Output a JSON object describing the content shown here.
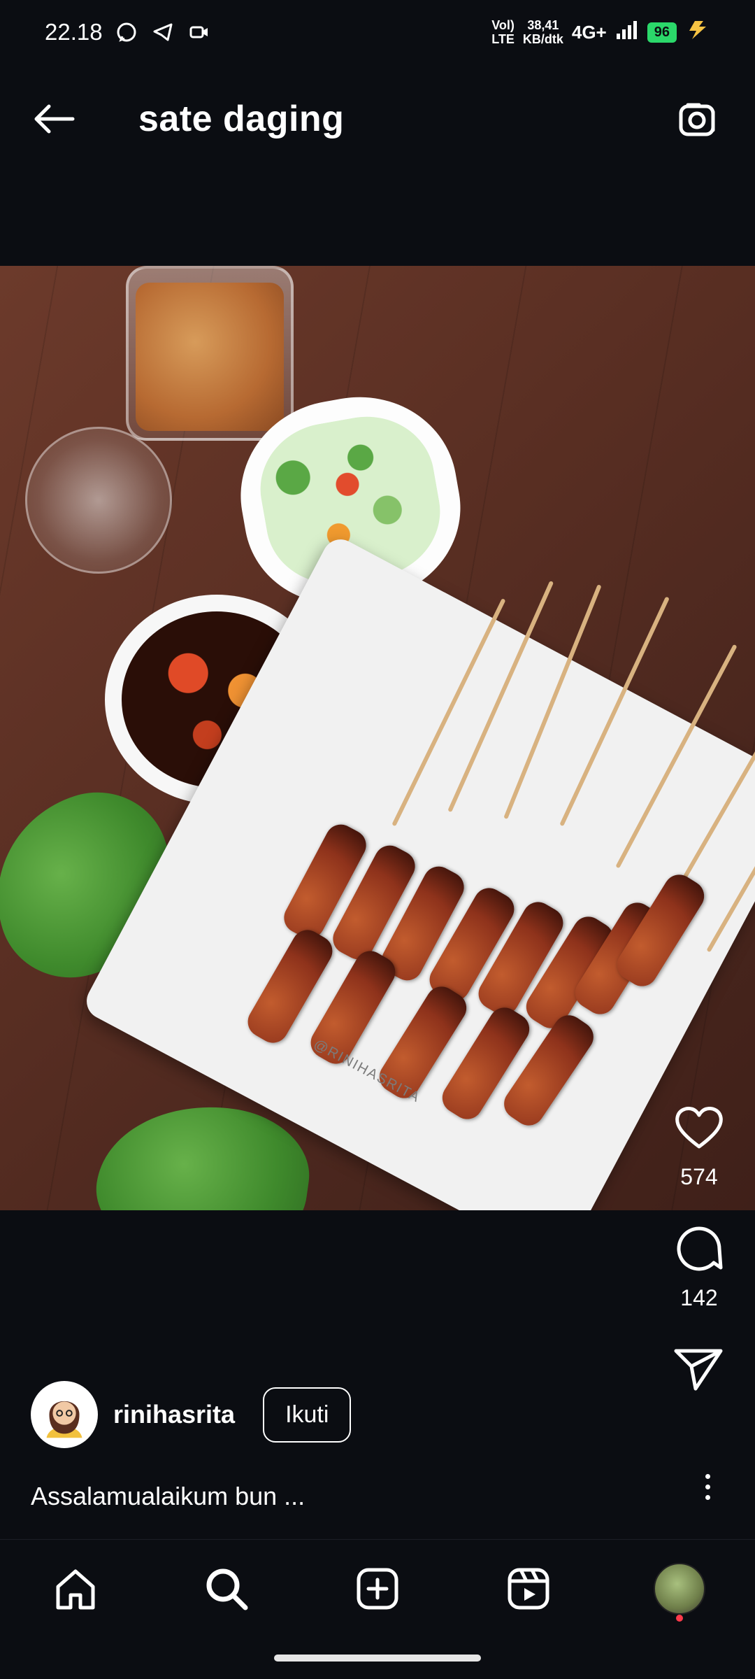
{
  "status_bar": {
    "time": "22.18",
    "volte_top": "Vol)",
    "volte_bottom": "LTE",
    "speed_value": "38,41",
    "speed_unit": "KB/dtk",
    "network": "4G+",
    "battery": "96"
  },
  "header": {
    "title": "sate daging"
  },
  "post": {
    "watermark": "@RINIHASRITA",
    "likes": "574",
    "comments": "142",
    "author": "rinihasrita",
    "follow_label": "Ikuti",
    "caption": "Assalamualaikum bun ..."
  },
  "colors": {
    "background": "#0b0d12",
    "battery": "#2bd86a",
    "notification_dot": "#ff3a4a"
  },
  "icons": {
    "back": "arrow-left-icon",
    "camera": "camera-icon",
    "like": "heart-icon",
    "comment": "comment-icon",
    "share": "send-icon",
    "more": "more-vertical-icon",
    "home": "home-icon",
    "search": "search-icon",
    "create": "plus-square-icon",
    "reels": "reels-icon",
    "profile": "profile-avatar"
  }
}
